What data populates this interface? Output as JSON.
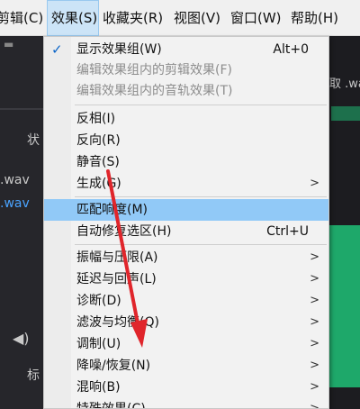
{
  "menubar": {
    "items": [
      {
        "label": "剪辑(C)"
      },
      {
        "label": "效果(S)"
      },
      {
        "label": "收藏夹(R)"
      },
      {
        "label": "视图(V)"
      },
      {
        "label": "窗口(W)"
      },
      {
        "label": "帮助(H)"
      }
    ]
  },
  "background": {
    "state_label": "状",
    "file1": ".wav",
    "file2": ".wav",
    "right_label": "取 .wav",
    "bottom_label": "标"
  },
  "effects_menu": {
    "items": [
      {
        "label": "显示效果组(W)",
        "shortcut": "Alt+0",
        "checked": true
      },
      {
        "label": "编辑效果组内的剪辑效果(F)",
        "disabled": true
      },
      {
        "label": "编辑效果组内的音轨效果(T)",
        "disabled": true
      },
      {
        "label": "反相(I)"
      },
      {
        "label": "反向(R)"
      },
      {
        "label": "静音(S)"
      },
      {
        "label": "生成(G)",
        "submenu": true
      },
      {
        "label": "匹配响度(M)",
        "highlighted": true
      },
      {
        "label": "自动修复选区(H)",
        "shortcut": "Ctrl+U"
      },
      {
        "label": "振幅与压限(A)",
        "submenu": true
      },
      {
        "label": "延迟与回声(L)",
        "submenu": true
      },
      {
        "label": "诊断(D)",
        "submenu": true
      },
      {
        "label": "滤波与均衡(Q)",
        "submenu": true
      },
      {
        "label": "调制(U)",
        "submenu": true
      },
      {
        "label": "降噪/恢复(N)",
        "submenu": true
      },
      {
        "label": "混响(B)",
        "submenu": true
      },
      {
        "label": "特殊效果(C)",
        "submenu": true
      }
    ]
  },
  "annotation": {
    "color": "#e0252b"
  },
  "colors": {
    "highlight": "#91c9f7",
    "checkmark": "#0a64c8",
    "waveform": "#1ea86a"
  }
}
